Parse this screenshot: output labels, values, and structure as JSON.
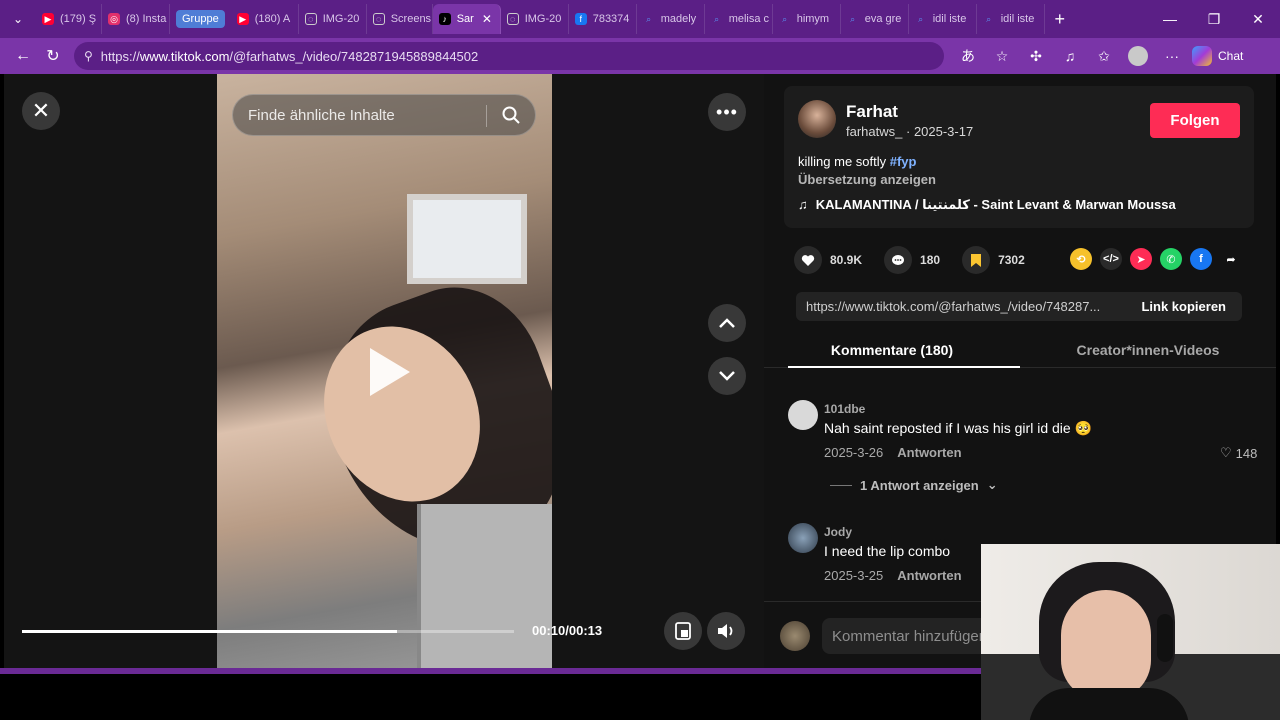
{
  "browser": {
    "tabs": [
      {
        "label": "(179) Ş",
        "icon": "youtube-icon",
        "color": "#ff0033"
      },
      {
        "label": "(8) Insta",
        "icon": "instagram-icon",
        "color": "#e1306c"
      },
      {
        "label": "Gruppe",
        "icon": "",
        "color": "#4f7dd6",
        "group": true
      },
      {
        "label": "(180) A",
        "icon": "youtube-icon",
        "color": "#ff0033"
      },
      {
        "label": "IMG-20",
        "icon": "globe-icon",
        "color": "#999999"
      },
      {
        "label": "Screens",
        "icon": "globe-icon",
        "color": "#999999"
      },
      {
        "label": "Sar",
        "icon": "tiktok-icon",
        "color": "#000000",
        "active": true
      },
      {
        "label": "IMG-20",
        "icon": "globe-icon",
        "color": "#999999"
      },
      {
        "label": "783374",
        "icon": "facebook-icon",
        "color": "#1877f2"
      },
      {
        "label": "madely",
        "icon": "search-icon",
        "color": "#5b8def"
      },
      {
        "label": "melisa c",
        "icon": "search-icon",
        "color": "#5b8def"
      },
      {
        "label": "himym",
        "icon": "search-icon",
        "color": "#5b8def"
      },
      {
        "label": "eva gre",
        "icon": "search-icon",
        "color": "#5b8def"
      },
      {
        "label": "idil iste",
        "icon": "search-icon",
        "color": "#5b8def"
      },
      {
        "label": "idil iste",
        "icon": "search-icon",
        "color": "#5b8def"
      }
    ],
    "url_prefix": "https://",
    "url_host": "www.tiktok.com",
    "url_path": "/@farhatws_/video/7482871945889844502",
    "chat_label": "Chat"
  },
  "video": {
    "search_placeholder": "Finde ähnliche Inhalte",
    "time": "00:10/00:13",
    "progress": 0.762
  },
  "post": {
    "author_name": "Farhat",
    "author_handle": "farhatws_",
    "date_sep": " · ",
    "date": "2025-3-17",
    "follow_label": "Folgen",
    "caption": "killing me softly ",
    "hashtag": "#fyp",
    "translate_label": "Übersetzung anzeigen",
    "music": "KALAMANTINA / كلمنتينا - Saint Levant & Marwan Moussa",
    "likes": "80.9K",
    "comments": "180",
    "saves": "7302",
    "link_url": "https://www.tiktok.com/@farhatws_/video/748287...",
    "copy_label": "Link kopieren",
    "colors": {
      "follow": "#fe2c55",
      "hashtag": "#7fb2ff"
    }
  },
  "tabs": {
    "comments": "Kommentare (180)",
    "creator": "Creator*innen-Videos"
  },
  "comments": [
    {
      "user": "101dbe",
      "text": "Nah saint reposted if I was his girl id die 🥺",
      "date": "2025-3-26",
      "reply": "Antworten",
      "likes": "148",
      "replies": "1 Antwort anzeigen"
    },
    {
      "user": "Jody",
      "text": "I need the lip combo",
      "date": "2025-3-25",
      "reply": "Antworten"
    }
  ],
  "comment_input": {
    "placeholder": "Kommentar hinzufügen..."
  }
}
